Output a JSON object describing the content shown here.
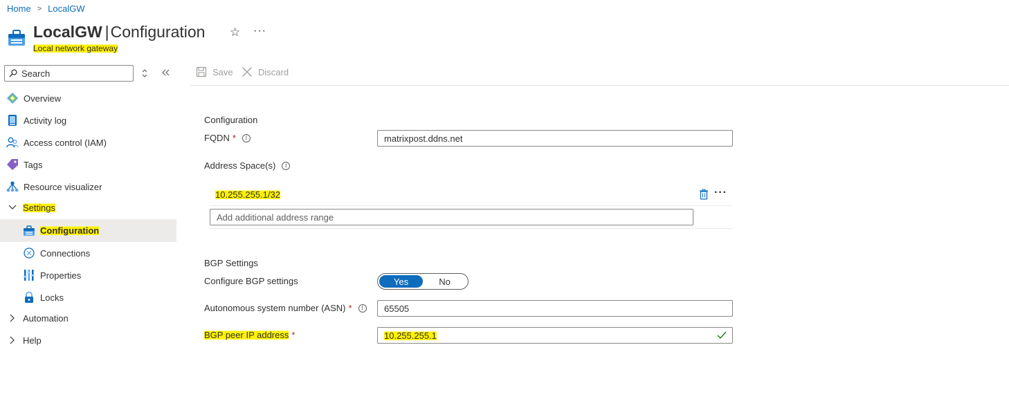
{
  "breadcrumb": {
    "home": "Home",
    "current": "LocalGW"
  },
  "header": {
    "resource_name": "LocalGW",
    "separator": "|",
    "page": "Configuration",
    "subtitle": "Local network gateway",
    "star_glyph": "☆",
    "more_glyph": "···"
  },
  "sidebar": {
    "search_placeholder": "Search",
    "items": [
      {
        "label": "Overview",
        "icon": "overview-icon"
      },
      {
        "label": "Activity log",
        "icon": "activity-log-icon"
      },
      {
        "label": "Access control (IAM)",
        "icon": "iam-icon"
      },
      {
        "label": "Tags",
        "icon": "tag-icon"
      },
      {
        "label": "Resource visualizer",
        "icon": "resource-visualizer-icon"
      },
      {
        "label": "Settings",
        "icon": "chevron-down-icon",
        "expanded": true
      },
      {
        "label": "Configuration",
        "icon": "gateway-icon",
        "selected": true
      },
      {
        "label": "Connections",
        "icon": "connections-icon"
      },
      {
        "label": "Properties",
        "icon": "properties-icon"
      },
      {
        "label": "Locks",
        "icon": "lock-icon"
      },
      {
        "label": "Automation",
        "icon": "chevron-right-icon",
        "expanded": false
      },
      {
        "label": "Help",
        "icon": "chevron-right-icon",
        "expanded": false
      }
    ]
  },
  "toolbar": {
    "save_label": "Save",
    "discard_label": "Discard"
  },
  "form": {
    "config_section": "Configuration",
    "fqdn_label": "FQDN",
    "fqdn_value": "matrixpost.ddns.net",
    "address_space_label": "Address Space(s)",
    "address_value": "10.255.255.1/32",
    "address_add_placeholder": "Add additional address range",
    "bgp_section": "BGP Settings",
    "configure_bgp_label": "Configure BGP settings",
    "bgp_yes": "Yes",
    "bgp_no": "No",
    "bgp_selected": "Yes",
    "asn_label": "Autonomous system number (ASN)",
    "asn_value": "65505",
    "peer_ip_label": "BGP peer IP address",
    "peer_ip_value": "10.255.255.1",
    "required_marker": "*",
    "info_glyph": "i"
  },
  "colors": {
    "accent": "#0f6cbd",
    "highlight": "#fff200",
    "required": "#a4262c",
    "valid": "#107c10"
  }
}
